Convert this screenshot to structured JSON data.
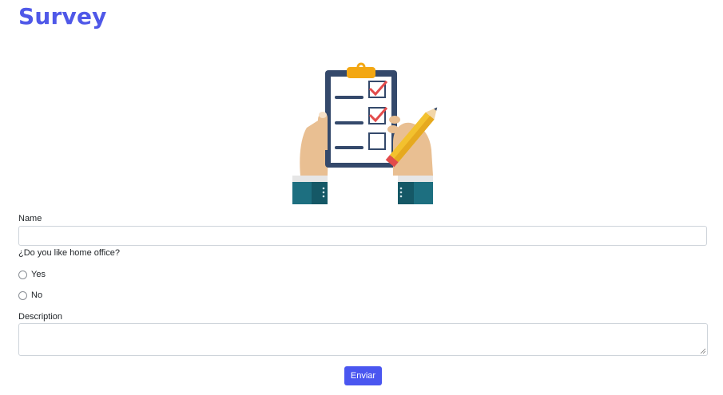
{
  "page": {
    "title": "Survey"
  },
  "illustration": {
    "icon": "clipboard-checklist-icon"
  },
  "form": {
    "name_label": "Name",
    "name_value": "",
    "question_label": "¿Do you like home office?",
    "options": [
      {
        "label": "Yes",
        "selected": false
      },
      {
        "label": "No",
        "selected": false
      }
    ],
    "description_label": "Description",
    "description_value": "",
    "submit_label": "Enviar"
  },
  "colors": {
    "accent": "#4f58e8",
    "button": "#4a56f0",
    "border": "#ced4da"
  }
}
